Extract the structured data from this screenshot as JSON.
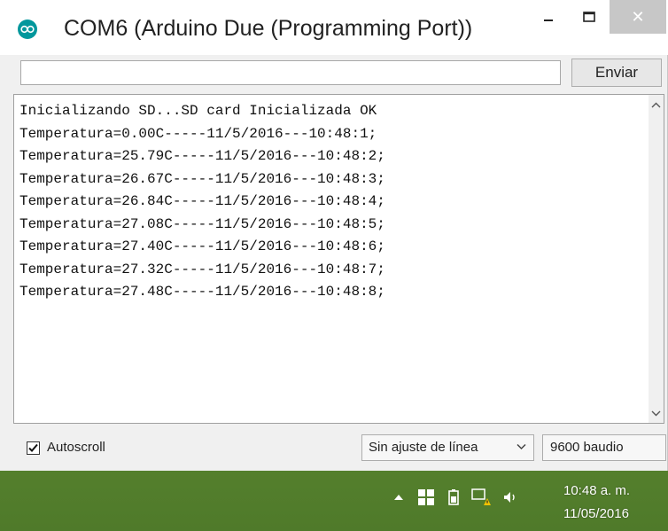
{
  "window": {
    "title": "COM6 (Arduino Due (Programming Port))",
    "close_glyph": "✕"
  },
  "send": {
    "input_value": "",
    "button_label": "Enviar"
  },
  "output": {
    "lines": [
      "Inicializando SD...SD card Inicializada OK",
      "Temperatura=0.00C-----11/5/2016---10:48:1;",
      "Temperatura=25.79C-----11/5/2016---10:48:2;",
      "Temperatura=26.67C-----11/5/2016---10:48:3;",
      "Temperatura=26.84C-----11/5/2016---10:48:4;",
      "Temperatura=27.08C-----11/5/2016---10:48:5;",
      "Temperatura=27.40C-----11/5/2016---10:48:6;",
      "Temperatura=27.32C-----11/5/2016---10:48:7;",
      "Temperatura=27.48C-----11/5/2016---10:48:8;"
    ]
  },
  "bottom": {
    "autoscroll_label": "Autoscroll",
    "autoscroll_checked": true,
    "line_ending": "Sin ajuste de línea",
    "baud_rate": "9600 baudio"
  },
  "tray": {
    "time": "10:48 a. m.",
    "date": "11/05/2016"
  },
  "icons": [
    "arduino-icon",
    "minimize-icon",
    "maximize-icon",
    "close-icon",
    "chevron-up-icon",
    "chevron-down-icon",
    "checkmark-icon",
    "caret-up-icon",
    "windows-flag-icon",
    "battery-icon",
    "network-warning-icon",
    "speaker-icon"
  ],
  "colors": {
    "arduino_teal": "#00979c",
    "close_button": "#c7c7c7"
  }
}
